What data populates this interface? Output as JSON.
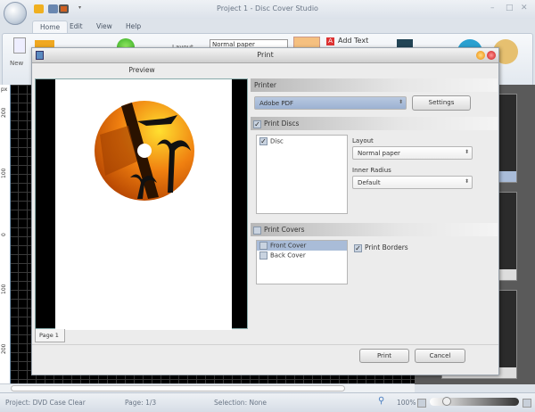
{
  "app": {
    "title": "Project 1 - Disc Cover Studio",
    "tabs": [
      "Home",
      "Edit",
      "View",
      "Help"
    ],
    "active_tab": "Home",
    "ribbon": {
      "new_label": "New",
      "layout_label": "Layout",
      "layout_value": "Normal paper",
      "add_text_label": "Add Text"
    }
  },
  "ruler": {
    "unit": "px",
    "labels": [
      "200",
      "100",
      "0",
      "100",
      "200"
    ]
  },
  "status": {
    "project": "Project: DVD Case Clear",
    "page": "Page: 1/3",
    "selection": "Selection: None",
    "zoom": "100%",
    "zoom_fraction": 0.2
  },
  "dialog": {
    "title": "Print",
    "preview_label": "Preview",
    "page_tab": "Page 1",
    "printer": {
      "header": "Printer",
      "selected": "Adobe PDF",
      "settings_label": "Settings"
    },
    "print_discs": {
      "header": "Print Discs",
      "checked": true,
      "items": [
        {
          "label": "Disc",
          "checked": true
        }
      ],
      "layout_label": "Layout",
      "layout_value": "Normal paper",
      "inner_radius_label": "Inner Radius",
      "inner_radius_value": "Default"
    },
    "print_covers": {
      "header": "Print Covers",
      "checked": false,
      "items": [
        {
          "label": "Front Cover",
          "selected": true
        },
        {
          "label": "Back Cover",
          "selected": false
        }
      ],
      "print_borders_label": "Print Borders",
      "print_borders_checked": true
    },
    "print_label": "Print",
    "cancel_label": "Cancel"
  },
  "colors": {
    "selection": "#a9bcd8",
    "disc_orange": "#e8770f"
  }
}
